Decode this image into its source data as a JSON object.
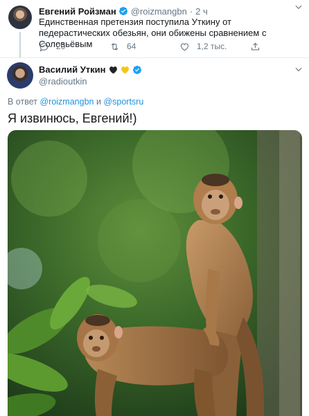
{
  "parent_tweet": {
    "author_name": "Евгений Ройзман",
    "handle": "@roizmangbn",
    "separator": "·",
    "time": "2 ч",
    "text": "Единственная претензия поступила Уткину от педерастических обезьян, они обижены сравнением с Соловьёвым",
    "replies": "20",
    "retweets": "64",
    "likes": "1,2 тыс.",
    "icons": [
      "reply-icon",
      "retweet-icon",
      "like-icon",
      "share-icon",
      "verified-icon",
      "chevron-down-icon"
    ]
  },
  "main_tweet": {
    "author_name": "Василий Уткин",
    "emoji": [
      "black-heart",
      "yellow-heart"
    ],
    "handle": "@radioutkin",
    "reply_prefix": "В ответ",
    "reply_user1": "@roizmangbn",
    "reply_conj": "и",
    "reply_user2": "@sportsru",
    "text": "Я извинюсь, Евгений!)",
    "photo": "two-monkeys-photo"
  },
  "colors": {
    "link": "#1b95e0",
    "verified": "#1da1f2",
    "secondary_text": "#657786",
    "primary_text": "#14171a"
  }
}
